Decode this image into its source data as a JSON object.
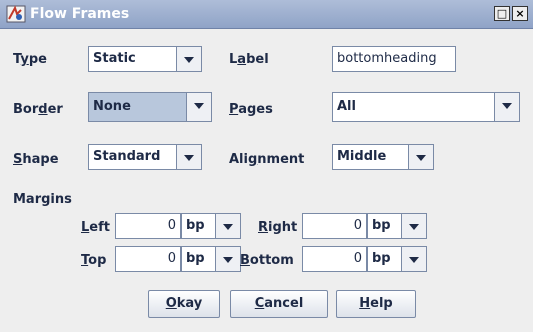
{
  "window": {
    "title": "Flow Frames",
    "buttons": {
      "maximize": "□",
      "close": "×"
    }
  },
  "fields": {
    "type": {
      "label_pre": "T",
      "label_ul": "y",
      "label_post": "pe",
      "value": "Static"
    },
    "label": {
      "label_pre": "L",
      "label_ul": "a",
      "label_post": "bel",
      "value": "bottomheading"
    },
    "border": {
      "label_pre": "Bor",
      "label_ul": "d",
      "label_post": "er",
      "value": "None"
    },
    "pages": {
      "label_pre": "",
      "label_ul": "P",
      "label_post": "ages",
      "value": "All"
    },
    "shape": {
      "label_pre": "",
      "label_ul": "S",
      "label_post": "hape",
      "value": "Standard"
    },
    "alignment": {
      "label_pre": "Ali",
      "label_ul": "g",
      "label_post": "nment",
      "value": "Middle"
    }
  },
  "margins": {
    "heading": "Margins",
    "left": {
      "label_pre": "",
      "label_ul": "L",
      "label_post": "eft",
      "value": "0",
      "unit": "bp"
    },
    "right": {
      "label_pre": "",
      "label_ul": "R",
      "label_post": "ight",
      "value": "0",
      "unit": "bp"
    },
    "top": {
      "label_pre": "",
      "label_ul": "T",
      "label_post": "op",
      "value": "0",
      "unit": "bp"
    },
    "bottom": {
      "label_pre": "",
      "label_ul": "B",
      "label_post": "ottom",
      "value": "0",
      "unit": "bp"
    }
  },
  "actions": {
    "okay": {
      "pre": "",
      "ul": "O",
      "post": "kay"
    },
    "cancel": {
      "pre": "",
      "ul": "C",
      "post": "ancel"
    },
    "help": {
      "pre": "",
      "ul": "H",
      "post": "elp"
    }
  },
  "colors": {
    "titlebar": "#9fb0d0",
    "selected_combo": "#b8c7dc",
    "text": "#1e2a46"
  }
}
